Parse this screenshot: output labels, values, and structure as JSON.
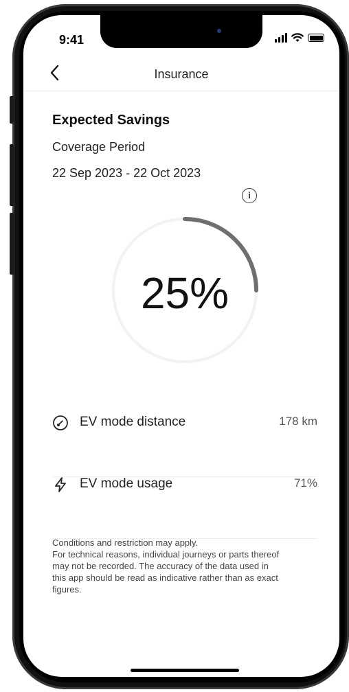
{
  "status_bar": {
    "time": "9:41"
  },
  "header": {
    "title": "Insurance",
    "back_icon": "chevron-left-icon"
  },
  "savings": {
    "title": "Expected Savings",
    "coverage_label": "Coverage Period",
    "coverage_dates": "22 Sep 2023 - 22 Oct 2023",
    "info_icon": "info-icon",
    "percent_text": "25%",
    "percent_value": 25
  },
  "metrics": [
    {
      "icon": "speedometer-icon",
      "label": "EV mode distance",
      "value": "178 km"
    },
    {
      "icon": "lightning-icon",
      "label": "EV mode usage",
      "value": "71%"
    }
  ],
  "disclaimer": [
    "Conditions and restriction may apply.",
    "For technical reasons, individual journeys or parts thereof",
    "may not be recorded. The accuracy of the data used in",
    "this app should be read as indicative rather than as exact",
    "figures."
  ],
  "colors": {
    "progress": "#6f6f72",
    "track": "#f2f2f2"
  }
}
